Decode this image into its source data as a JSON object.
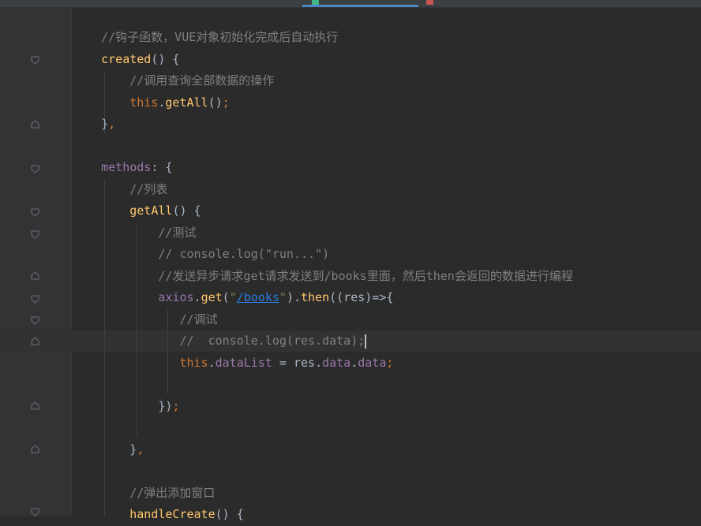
{
  "editor": {
    "language": "JavaScript (Vue)",
    "lines": [
      {
        "indent": 4,
        "tokens": [
          {
            "t": "comment",
            "v": "//钩子函数，VUE对象初始化完成后自动执行"
          }
        ]
      },
      {
        "indent": 4,
        "tokens": [
          {
            "t": "fn",
            "v": "created"
          },
          {
            "t": "plain",
            "v": "() {"
          }
        ]
      },
      {
        "indent": 8,
        "tokens": [
          {
            "t": "comment",
            "v": "//调用查询全部数据的操作"
          }
        ]
      },
      {
        "indent": 8,
        "tokens": [
          {
            "t": "kw",
            "v": "this"
          },
          {
            "t": "plain",
            "v": "."
          },
          {
            "t": "fn",
            "v": "getAll"
          },
          {
            "t": "plain",
            "v": "()"
          },
          {
            "t": "kw",
            "v": ";"
          }
        ]
      },
      {
        "indent": 4,
        "tokens": [
          {
            "t": "plain",
            "v": "}"
          },
          {
            "t": "kw",
            "v": ","
          }
        ]
      },
      {
        "indent": 0,
        "tokens": []
      },
      {
        "indent": 4,
        "tokens": [
          {
            "t": "prop",
            "v": "methods"
          },
          {
            "t": "plain",
            "v": ": {"
          }
        ]
      },
      {
        "indent": 8,
        "tokens": [
          {
            "t": "comment",
            "v": "//列表"
          }
        ]
      },
      {
        "indent": 8,
        "tokens": [
          {
            "t": "fn",
            "v": "getAll"
          },
          {
            "t": "plain",
            "v": "() {"
          }
        ]
      },
      {
        "indent": 12,
        "tokens": [
          {
            "t": "comment",
            "v": "//测试"
          }
        ]
      },
      {
        "indent": 12,
        "tokens": [
          {
            "t": "comment",
            "v": "// console.log(\"run...\")"
          }
        ]
      },
      {
        "indent": 12,
        "tokens": [
          {
            "t": "comment",
            "v": "//发送异步请求get请求发送到/books里面，然后then会返回的数据进行编程"
          }
        ]
      },
      {
        "indent": 12,
        "tokens": [
          {
            "t": "prop",
            "v": "axios"
          },
          {
            "t": "plain",
            "v": "."
          },
          {
            "t": "fn",
            "v": "get"
          },
          {
            "t": "plain",
            "v": "("
          },
          {
            "t": "str",
            "v": "\""
          },
          {
            "t": "link",
            "v": "/books"
          },
          {
            "t": "str",
            "v": "\""
          },
          {
            "t": "plain",
            "v": ")."
          },
          {
            "t": "fn",
            "v": "then"
          },
          {
            "t": "plain",
            "v": "((res)=>{"
          }
        ]
      },
      {
        "indent": 15,
        "tokens": [
          {
            "t": "comment",
            "v": "//调试"
          }
        ]
      },
      {
        "indent": 15,
        "tokens": [
          {
            "t": "comment",
            "v": "//  console.log(res.data);"
          }
        ],
        "cursor": true
      },
      {
        "indent": 15,
        "tokens": [
          {
            "t": "kw",
            "v": "this"
          },
          {
            "t": "plain",
            "v": "."
          },
          {
            "t": "prop",
            "v": "dataList"
          },
          {
            "t": "plain",
            "v": " = res."
          },
          {
            "t": "prop",
            "v": "data"
          },
          {
            "t": "plain",
            "v": "."
          },
          {
            "t": "prop",
            "v": "data"
          },
          {
            "t": "kw",
            "v": ";"
          }
        ]
      },
      {
        "indent": 0,
        "tokens": []
      },
      {
        "indent": 12,
        "tokens": [
          {
            "t": "plain",
            "v": "})"
          },
          {
            "t": "kw",
            "v": ";"
          }
        ]
      },
      {
        "indent": 0,
        "tokens": []
      },
      {
        "indent": 8,
        "tokens": [
          {
            "t": "plain",
            "v": "}"
          },
          {
            "t": "kw",
            "v": ","
          }
        ]
      },
      {
        "indent": 0,
        "tokens": []
      },
      {
        "indent": 8,
        "tokens": [
          {
            "t": "comment",
            "v": "//弹出添加窗口"
          }
        ]
      },
      {
        "indent": 8,
        "tokens": [
          {
            "t": "fn",
            "v": "handleCreate"
          },
          {
            "t": "plain",
            "v": "() {"
          }
        ]
      }
    ]
  },
  "colors": {
    "background": "#2b2b2b",
    "gutter": "#313335",
    "comment": "#808080",
    "function": "#ffc66d",
    "keyword": "#cc7832",
    "property": "#9876aa",
    "string": "#6a8759",
    "link": "#287bde",
    "text": "#a9b7c6",
    "active_tab_underline": "#4a88c7"
  }
}
